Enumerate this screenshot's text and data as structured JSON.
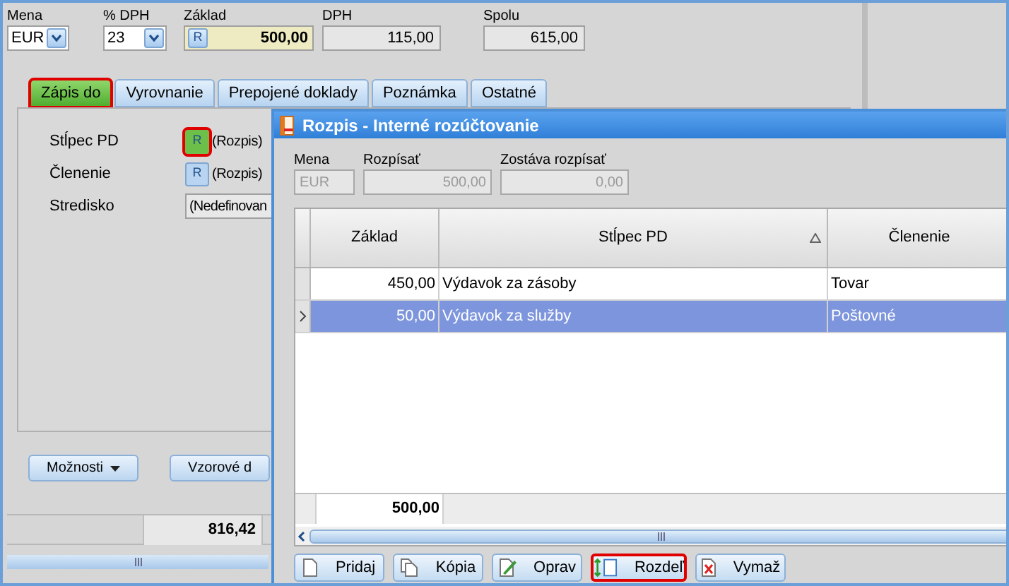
{
  "main_form": {
    "fields": [
      {
        "label": "Mena",
        "value": "EUR",
        "kind": "combo"
      },
      {
        "label": "% DPH",
        "value": "23",
        "kind": "combo"
      },
      {
        "label": "Základ",
        "value": "500,00",
        "kind": "split",
        "button": "R"
      },
      {
        "label": "DPH",
        "value": "115,00",
        "kind": "amount"
      },
      {
        "label": "Spolu",
        "value": "615,00",
        "kind": "amount"
      }
    ],
    "tabs": [
      {
        "label": "Zápis do",
        "selected": true,
        "highlighted": true
      },
      {
        "label": "Vyrovnanie",
        "selected": false,
        "highlighted": false
      },
      {
        "label": "Prepojené doklady",
        "selected": false,
        "highlighted": false
      },
      {
        "label": "Poznámka",
        "selected": false,
        "highlighted": false
      },
      {
        "label": "Ostatné",
        "selected": false,
        "highlighted": false
      }
    ],
    "rows": [
      {
        "label": "Stĺpec PD",
        "value": "(Rozpis)",
        "kind": "split",
        "button": "R",
        "highlighted": true
      },
      {
        "label": "Členenie",
        "value": "(Rozpis)",
        "kind": "split",
        "button": "R",
        "highlighted": false
      },
      {
        "label": "Stredisko",
        "value": "(Nedefinovan",
        "kind": "combo",
        "highlighted": false
      }
    ],
    "buttons": [
      {
        "label": "Možnosti",
        "kind": "menu"
      },
      {
        "label": "Vzorové d",
        "kind": "plain"
      }
    ],
    "total": "816,42"
  },
  "dialog": {
    "title": "Rozpis - Interné rozúčtovanie",
    "fields": [
      {
        "label": "Mena",
        "value": "EUR",
        "disabled": true
      },
      {
        "label": "Rozpísať",
        "value": "500,00",
        "disabled": true
      },
      {
        "label": "Zostáva rozpísať",
        "value": "0,00",
        "disabled": true
      }
    ],
    "table": {
      "columns": [
        {
          "label": "Základ",
          "sorted": false
        },
        {
          "label": "Stĺpec PD",
          "sorted": true
        },
        {
          "label": "Členenie",
          "sorted": false
        }
      ],
      "rows": [
        {
          "cells": [
            "450,00",
            "Výdavok za zásoby",
            "Tovar"
          ],
          "selected": false
        },
        {
          "cells": [
            "50,00",
            "Výdavok za služby",
            "Poštovné"
          ],
          "selected": true
        }
      ],
      "footer": "500,00"
    },
    "buttons": [
      {
        "label": "Pridaj",
        "kind": "add",
        "highlighted": false
      },
      {
        "label": "Kópia",
        "kind": "copy",
        "highlighted": false
      },
      {
        "label": "Oprav",
        "kind": "edit",
        "highlighted": false
      },
      {
        "label": "Rozdeľ",
        "kind": "split",
        "highlighted": true
      },
      {
        "label": "Vymaž",
        "kind": "delete",
        "highlighted": false
      }
    ]
  }
}
